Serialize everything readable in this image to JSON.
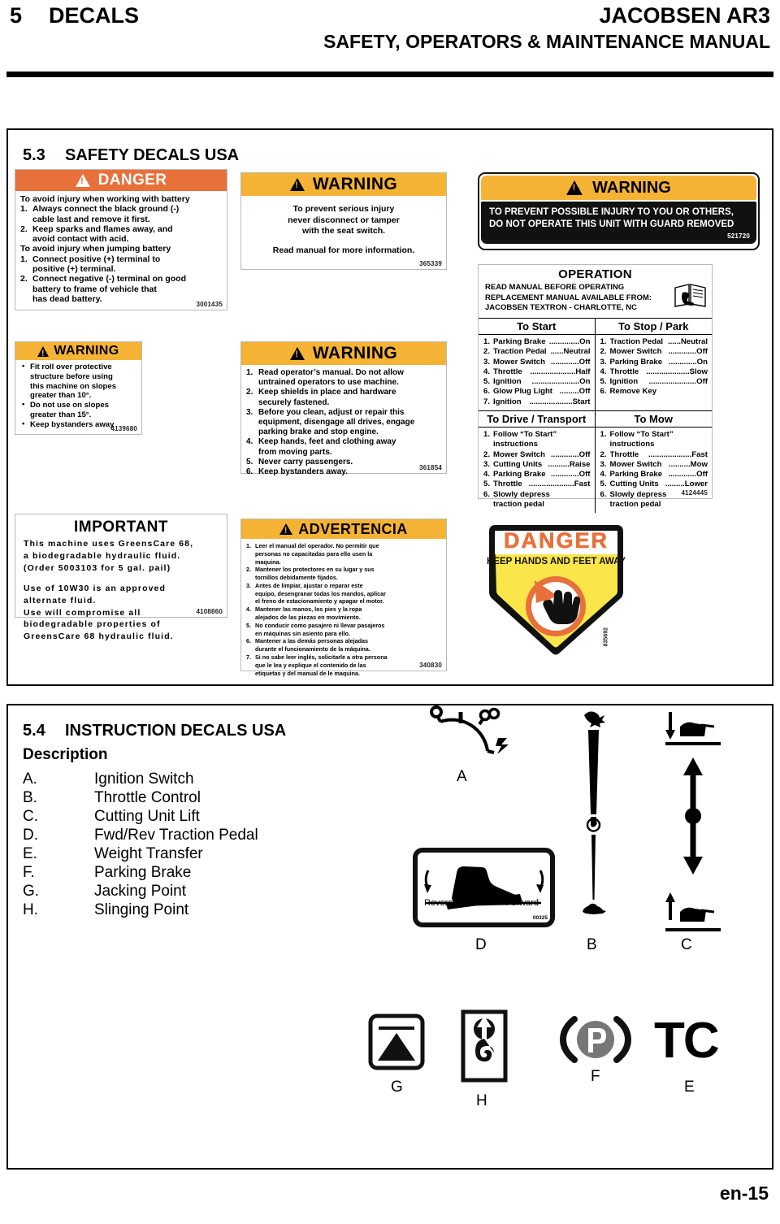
{
  "header": {
    "chapter_number": "5",
    "chapter_title": "DECALS",
    "model": "JACOBSEN AR3",
    "manual_title": "SAFETY, OPERATORS & MAINTENANCE MANUAL"
  },
  "footer": {
    "page": "en-15"
  },
  "section_safety": {
    "number": "5.3",
    "title": "SAFETY DECALS USA"
  },
  "section_instruction": {
    "number": "5.4",
    "title": "INSTRUCTION DECALS USA",
    "description_heading": "Description",
    "items": [
      {
        "key": "A.",
        "label": "Ignition Switch"
      },
      {
        "key": "B.",
        "label": "Throttle Control"
      },
      {
        "key": "C.",
        "label": "Cutting Unit Lift"
      },
      {
        "key": "D.",
        "label": "Fwd/Rev Traction Pedal"
      },
      {
        "key": "E.",
        "label": "Weight Transfer"
      },
      {
        "key": "F.",
        "label": "Parking Brake"
      },
      {
        "key": "G.",
        "label": "Jacking Point"
      },
      {
        "key": "H.",
        "label": "Slinging Point"
      }
    ],
    "icon_callouts": {
      "a": "A",
      "b": "B",
      "c": "C",
      "d": "D",
      "e": "E",
      "f": "F",
      "g": "G",
      "h": "H"
    },
    "pedal_decal": {
      "reverse": "Reverse",
      "forward": "Forward",
      "part_number": "00325"
    },
    "weight_transfer_text": "TC",
    "parking_brake_symbol": "P"
  },
  "decals": {
    "battery": {
      "band": "DANGER",
      "intro1": "To avoid injury when working with battery",
      "items1": [
        {
          "n": "1.",
          "lines": [
            "Always connect the black ground (-)",
            "cable last and remove it first."
          ]
        },
        {
          "n": "2.",
          "lines": [
            "Keep sparks and flames away, and",
            "avoid contact with acid."
          ]
        }
      ],
      "intro2": "To avoid injury when jumping battery",
      "items2": [
        {
          "n": "1.",
          "lines": [
            "Connect positive (+) terminal to",
            "positive (+) terminal."
          ]
        },
        {
          "n": "2.",
          "lines": [
            "Connect negative (-) terminal on good",
            "battery to frame of vehicle that",
            "has dead battery."
          ]
        }
      ],
      "part_number": "3001435"
    },
    "seat_switch": {
      "band": "WARNING",
      "lines": [
        "To prevent serious injury",
        "never disconnect or tamper",
        "with the seat switch."
      ],
      "footer_line": "Read manual for more information.",
      "part_number": "365339"
    },
    "guard": {
      "band": "WARNING",
      "lines": [
        "TO PREVENT POSSIBLE INJURY TO YOU OR OTHERS,",
        "DO NOT OPERATE THIS UNIT WITH GUARD REMOVED"
      ],
      "part_number": "521720"
    },
    "rops": {
      "band": "WARNING",
      "bullets": [
        [
          "Fit roll over protective",
          "structure before using",
          "this machine on slopes",
          "greater than 10°."
        ],
        [
          "Do not use on slopes",
          "greater than 15°."
        ],
        [
          "Keep bystanders away"
        ]
      ],
      "part_number": "4139680"
    },
    "general_warning": {
      "band": "WARNING",
      "items": [
        {
          "n": "1.",
          "lines": [
            "Read operator’s manual. Do not allow",
            "untrained operators to use machine."
          ]
        },
        {
          "n": "2.",
          "lines": [
            "Keep shields in place and hardware",
            "securely fastened."
          ]
        },
        {
          "n": "3.",
          "lines": [
            "Before you clean, adjust or repair this",
            "equipment,  disengage all drives, engage",
            "parking brake and stop engine."
          ]
        },
        {
          "n": "4.",
          "lines": [
            "Keep hands, feet and  clothing away",
            "from moving parts."
          ]
        },
        {
          "n": "5.",
          "lines": [
            "Never carry passengers."
          ]
        },
        {
          "n": "6.",
          "lines": [
            "Keep bystanders away."
          ]
        }
      ],
      "part_number": "361854"
    },
    "important": {
      "title": "IMPORTANT",
      "lines_block1": [
        "This machine uses GreensCare 68,",
        "a biodegradable hydraulic fluid.",
        "(Order 5003103 for 5 gal. pail)"
      ],
      "lines_block2": [
        "Use of 10W30 is an approved",
        "alternate fluid.",
        "Use will compromise all",
        "biodegradable properties of",
        "GreensCare 68 hydraulic fluid."
      ],
      "part_number": "4108860"
    },
    "advertencia": {
      "band": "ADVERTENCIA",
      "items": [
        {
          "n": "1.",
          "lines": [
            "Leer el manual del operador. No permitir que",
            "personas no capacitadas para ello usen la",
            "maquina."
          ]
        },
        {
          "n": "2.",
          "lines": [
            "Mantener los protectores en su lugar y sus",
            "tornillos debidamente fijados."
          ]
        },
        {
          "n": "3.",
          "lines": [
            "Antes de limpiar, ajustar o reparar este",
            "equipo, desengranar todas los mandos, aplicar",
            "el freno de estacionamiento y apagar el motor."
          ]
        },
        {
          "n": "4.",
          "lines": [
            "Mantener las manos, los pies y la ropa",
            "alejados de las piezas en movimiento."
          ]
        },
        {
          "n": "5.",
          "lines": [
            "No conducir como pasajero ni llevar pasajeros",
            "en máquinas sin asiento para ello."
          ]
        },
        {
          "n": "6.",
          "lines": [
            "Mantener a las demás personas alejadas",
            "durante el funcionamiento de la máquina."
          ]
        },
        {
          "n": "7.",
          "lines": [
            "Si no sabe leer inglés, solicitarle a otra persona",
            "que le lea y explique el contenido de las",
            "etiquetas y del manual de le maquina."
          ]
        }
      ],
      "part_number": "340830"
    },
    "hands": {
      "band": "DANGER",
      "subtitle": "KEEP HANDS AND FEET AWAY",
      "part_number": "835692"
    },
    "operation": {
      "title": "OPERATION",
      "manual_lines": [
        "READ MANUAL BEFORE OPERATING",
        "REPLACEMENT MANUAL AVAILABLE FROM:",
        "JACOBSEN TEXTRON - CHARLOTTE, NC"
      ],
      "part_number": "4124445",
      "tables": [
        {
          "heading": "To Start",
          "rows": [
            {
              "n": "1.",
              "label": "Parking Brake",
              "dots": "..............",
              "value": "On"
            },
            {
              "n": "2.",
              "label": "Traction Pedal",
              "dots": "......",
              "value": "Neutral"
            },
            {
              "n": "3.",
              "label": "Mower Switch",
              "dots": ".............",
              "value": "Off"
            },
            {
              "n": "4.",
              "label": "Throttle",
              "dots": ".....................",
              "value": "Half"
            },
            {
              "n": "5.",
              "label": "Ignition",
              "dots": "......................",
              "value": "On"
            },
            {
              "n": "6.",
              "label": "Glow Plug Light",
              "dots": ".........",
              "value": "Off"
            },
            {
              "n": "7.",
              "label": "Ignition",
              "dots": "....................",
              "value": "Start"
            }
          ]
        },
        {
          "heading": "To Stop / Park",
          "rows": [
            {
              "n": "1.",
              "label": "Traction Pedal",
              "dots": "......",
              "value": "Neutral"
            },
            {
              "n": "2.",
              "label": "Mower Switch",
              "dots": ".............",
              "value": "Off"
            },
            {
              "n": "3.",
              "label": "Parking Brake",
              "dots": ".............",
              "value": "On"
            },
            {
              "n": "4.",
              "label": "Throttle",
              "dots": "....................",
              "value": "Slow"
            },
            {
              "n": "5.",
              "label": "Ignition",
              "dots": "......................",
              "value": "Off"
            },
            {
              "n": "6.",
              "label": "Remove Key",
              "dots": "",
              "value": ""
            }
          ]
        },
        {
          "heading": "To Drive / Transport",
          "rows": [
            {
              "n": "1.",
              "label": "Follow “To Start”",
              "dots": "",
              "value": "",
              "cont": "instructions"
            },
            {
              "n": "2.",
              "label": "Mower Switch",
              "dots": ".............",
              "value": "Off"
            },
            {
              "n": "3.",
              "label": "Cutting Units",
              "dots": "..........",
              "value": "Raise"
            },
            {
              "n": "4.",
              "label": "Parking Brake",
              "dots": ".............",
              "value": "Off"
            },
            {
              "n": "5.",
              "label": "Throttle",
              "dots": ".....................",
              "value": "Fast"
            },
            {
              "n": "6.",
              "label": "Slowly depress",
              "dots": "",
              "value": "",
              "cont": "traction pedal"
            }
          ]
        },
        {
          "heading": "To Mow",
          "rows": [
            {
              "n": "1.",
              "label": "Follow “To Start”",
              "dots": "",
              "value": "",
              "cont": "instructions"
            },
            {
              "n": "2.",
              "label": "Throttle",
              "dots": "....................",
              "value": "Fast"
            },
            {
              "n": "3.",
              "label": "Mower Switch",
              "dots": "..........",
              "value": "Mow"
            },
            {
              "n": "4.",
              "label": "Parking Brake",
              "dots": ".............",
              "value": "Off"
            },
            {
              "n": "5.",
              "label": "Cutting Units",
              "dots": ".........",
              "value": "Lower"
            },
            {
              "n": "6.",
              "label": "Slowly depress",
              "dots": "",
              "value": "",
              "cont": "traction pedal"
            }
          ]
        }
      ]
    }
  },
  "colors": {
    "danger_orange": "#E8703A",
    "warning_amber": "#F5B335",
    "danger_shield_yellow": "#FAE64B",
    "black": "#111111"
  }
}
